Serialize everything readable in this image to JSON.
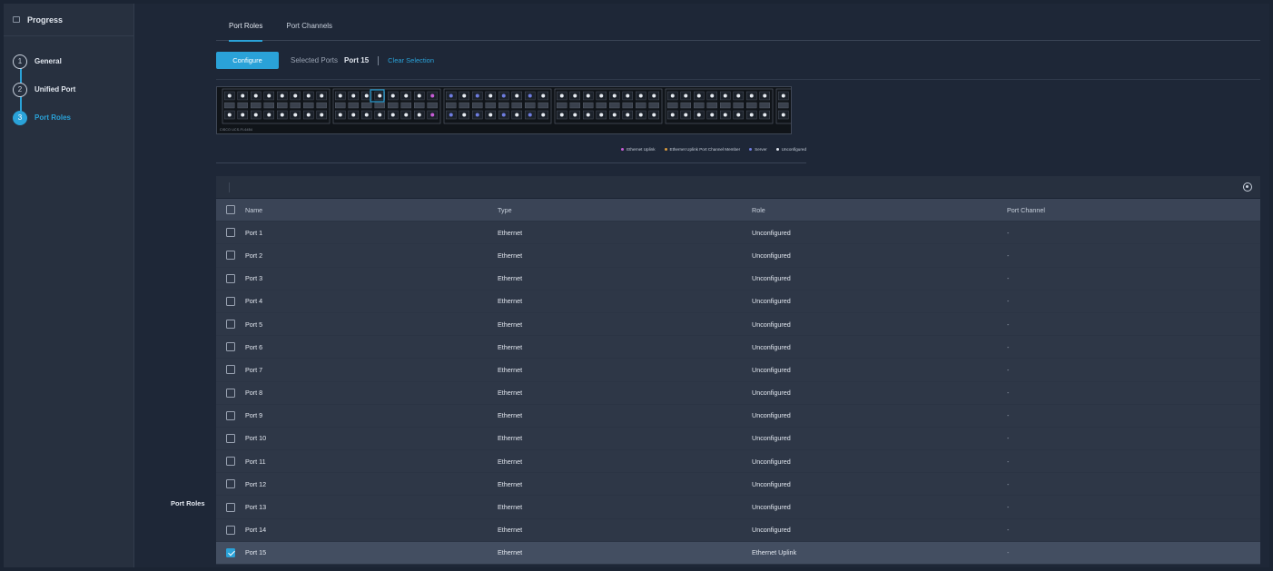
{
  "sidebar": {
    "title": "Progress",
    "steps": [
      {
        "num": "1",
        "label": "General"
      },
      {
        "num": "2",
        "label": "Unified Port"
      },
      {
        "num": "3",
        "label": "Port Roles"
      }
    ]
  },
  "tabs": [
    {
      "label": "Port Roles",
      "active": true
    },
    {
      "label": "Port Channels",
      "active": false
    }
  ],
  "toolbar": {
    "configure_label": "Configure",
    "selected_ports_label": "Selected Ports",
    "selected_ports_value": "Port 15",
    "clear_selection_label": "Clear Selection"
  },
  "switch": {
    "model": "CISCO UCS-FI-6454"
  },
  "legend": [
    {
      "label": "Ethernet Uplink",
      "color": "#c75cd6"
    },
    {
      "label": "Ethernet Uplink Port Channel Member",
      "color": "#d99a3e"
    },
    {
      "label": "Server",
      "color": "#6f7de0"
    },
    {
      "label": "Unconfigured",
      "color": "#e2e7ef"
    }
  ],
  "table": {
    "columns": [
      "Name",
      "Type",
      "Role",
      "Port Channel"
    ],
    "rows": [
      {
        "name": "Port 1",
        "type": "Ethernet",
        "role": "Unconfigured",
        "port_channel": "-",
        "checked": false
      },
      {
        "name": "Port 2",
        "type": "Ethernet",
        "role": "Unconfigured",
        "port_channel": "-",
        "checked": false
      },
      {
        "name": "Port 3",
        "type": "Ethernet",
        "role": "Unconfigured",
        "port_channel": "-",
        "checked": false
      },
      {
        "name": "Port 4",
        "type": "Ethernet",
        "role": "Unconfigured",
        "port_channel": "-",
        "checked": false
      },
      {
        "name": "Port 5",
        "type": "Ethernet",
        "role": "Unconfigured",
        "port_channel": "-",
        "checked": false
      },
      {
        "name": "Port 6",
        "type": "Ethernet",
        "role": "Unconfigured",
        "port_channel": "-",
        "checked": false
      },
      {
        "name": "Port 7",
        "type": "Ethernet",
        "role": "Unconfigured",
        "port_channel": "-",
        "checked": false
      },
      {
        "name": "Port 8",
        "type": "Ethernet",
        "role": "Unconfigured",
        "port_channel": "-",
        "checked": false
      },
      {
        "name": "Port 9",
        "type": "Ethernet",
        "role": "Unconfigured",
        "port_channel": "-",
        "checked": false
      },
      {
        "name": "Port 10",
        "type": "Ethernet",
        "role": "Unconfigured",
        "port_channel": "-",
        "checked": false
      },
      {
        "name": "Port 11",
        "type": "Ethernet",
        "role": "Unconfigured",
        "port_channel": "-",
        "checked": false
      },
      {
        "name": "Port 12",
        "type": "Ethernet",
        "role": "Unconfigured",
        "port_channel": "-",
        "checked": false
      },
      {
        "name": "Port 13",
        "type": "Ethernet",
        "role": "Unconfigured",
        "port_channel": "-",
        "checked": false
      },
      {
        "name": "Port 14",
        "type": "Ethernet",
        "role": "Unconfigured",
        "port_channel": "-",
        "checked": false
      },
      {
        "name": "Port 15",
        "type": "Ethernet",
        "role": "Ethernet Uplink",
        "port_channel": "-",
        "checked": true
      }
    ]
  },
  "tooltip": "Port Roles"
}
